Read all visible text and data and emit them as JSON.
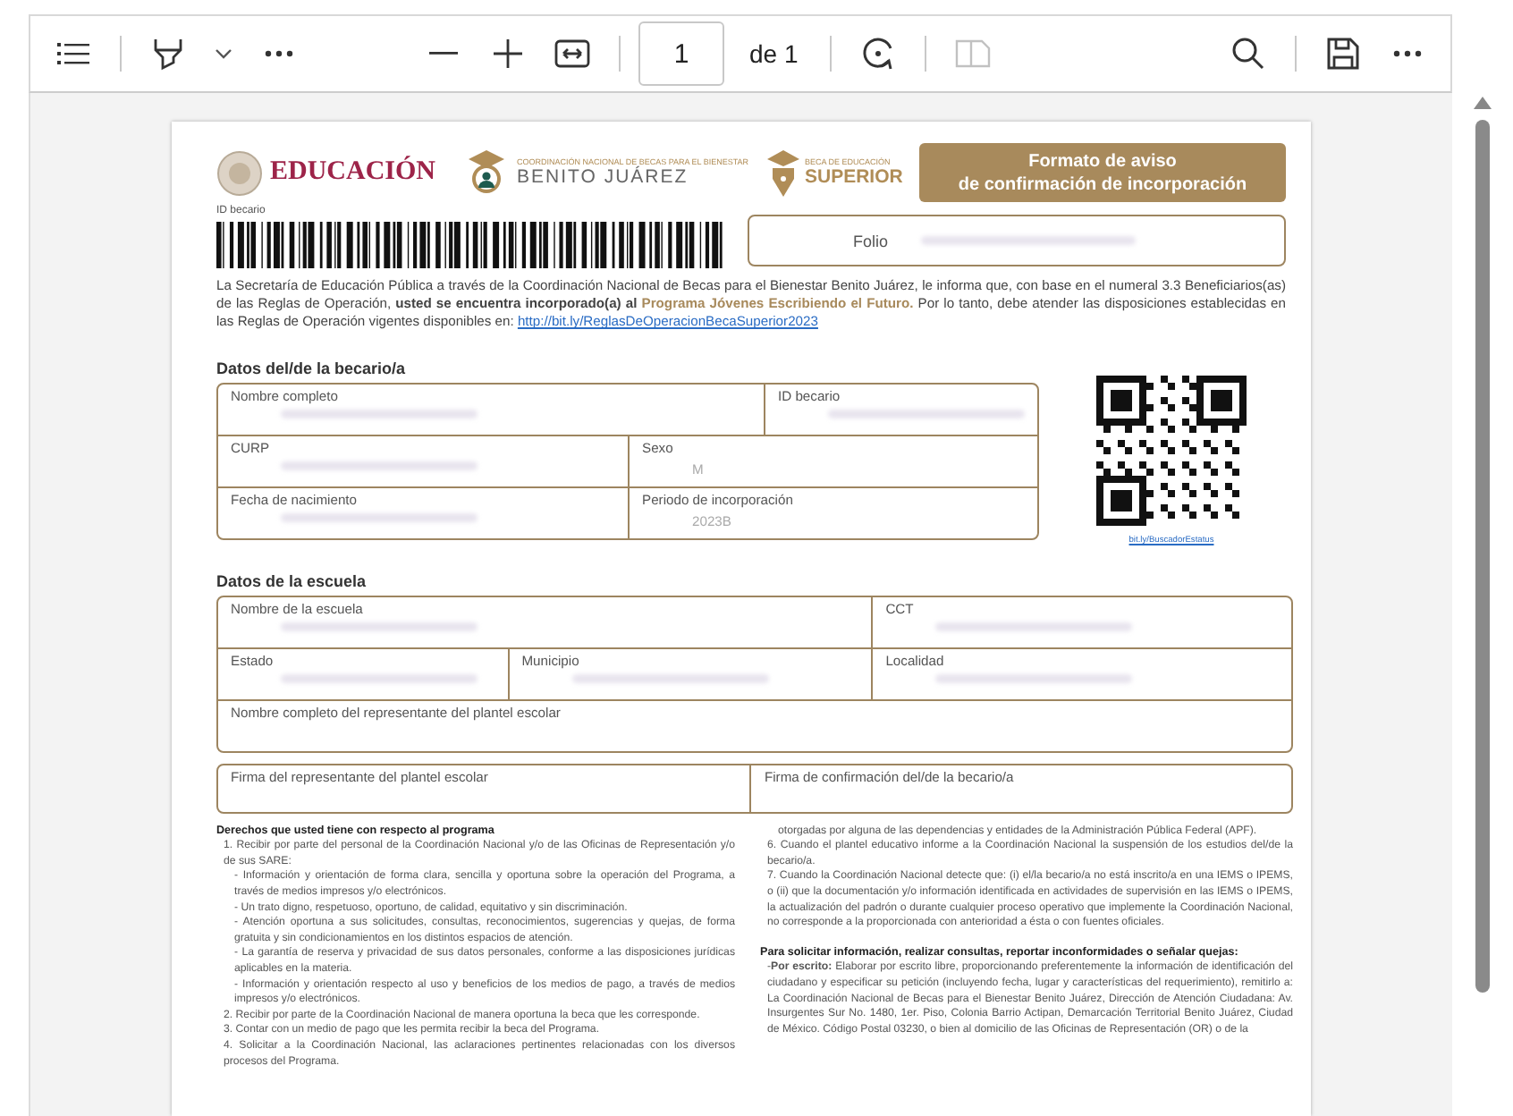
{
  "toolbar": {
    "left": [
      {
        "kind": "contents",
        "disabled": false
      },
      {
        "kind": "divider"
      },
      {
        "kind": "highlighter",
        "disabled": false
      },
      {
        "kind": "chevron",
        "disabled": false
      },
      {
        "kind": "more",
        "disabled": false
      }
    ],
    "center": [
      {
        "kind": "zoom-out",
        "disabled": false
      },
      {
        "kind": "zoom-in",
        "disabled": false
      },
      {
        "kind": "fit-width",
        "disabled": false
      },
      {
        "kind": "divider"
      },
      {
        "kind": "page-field",
        "value": "1"
      },
      {
        "kind": "page-count",
        "text": "de 1"
      },
      {
        "kind": "divider"
      },
      {
        "kind": "rotate",
        "disabled": false
      },
      {
        "kind": "divider"
      },
      {
        "kind": "two-page",
        "disabled": true
      }
    ],
    "right": [
      {
        "kind": "search",
        "disabled": false
      },
      {
        "kind": "divider"
      },
      {
        "kind": "save",
        "disabled": false
      },
      {
        "kind": "more",
        "disabled": false
      }
    ]
  },
  "document": {
    "logos": {
      "sep": "EDUCACIÓN",
      "coordination_small": "COORDINACIÓN NACIONAL DE BECAS PARA EL BIENESTAR",
      "coordination": "BENITO JUÁREZ",
      "scholarship_small": "BECA DE EDUCACIÓN",
      "scholarship": "SUPERIOR"
    },
    "title_lines": [
      "Formato de aviso",
      "de confirmación de incorporación"
    ],
    "barcode_label": "ID becario",
    "folio_label": "Folio",
    "intro": {
      "text": "La Secretaría de Educación Pública a través de la Coordinación Nacional de Becas para el Bienestar Benito Juárez, le informa que, con base en el numeral 3.3 Beneficiarios(as) de las Reglas de Operación, **usted se encuentra incorporado(a) al**",
      "program": "Programa Jóvenes Escribiendo el Futuro.",
      "after": "Por lo tanto, debe atender las disposiciones establecidas en las Reglas de Operación vigentes disponibles en:",
      "link": "http://bit.ly/ReglasDeOperacionBecaSuperior2023"
    },
    "student": {
      "heading": "Datos del/de la becario/a",
      "rows": [
        [
          {
            "label": "Nombre completo",
            "redacted": true
          },
          {
            "label": "ID becario",
            "redacted": true
          }
        ],
        [
          {
            "label": "CURP",
            "redacted": true
          },
          {
            "label": "Sexo",
            "value": "M"
          }
        ],
        [
          {
            "label": "Fecha de nacimiento",
            "redacted": true
          },
          {
            "label": "Periodo de incorporación",
            "value": "2023B"
          }
        ]
      ],
      "qr_link": "bit.ly/BuscadorEstatus"
    },
    "school": {
      "heading": "Datos de la escuela",
      "lines": [
        [
          {
            "label": "Nombre de la escuela",
            "redacted": true
          },
          {
            "label": "CCT",
            "redacted": true
          }
        ],
        [
          {
            "label": "Estado",
            "redacted": true
          },
          {
            "label": "Municipio",
            "redacted": true
          },
          {
            "label": "Localidad",
            "redacted": true
          }
        ],
        [
          {
            "label": "Nombre completo del representante del plantel escolar"
          }
        ]
      ]
    },
    "signatures": [
      {
        "label": "Firma del representante del plantel escolar"
      },
      {
        "label": "Firma de confirmación del/de la becario/a"
      }
    ],
    "rights": {
      "heading": "Derechos que usted tiene con respecto al programa",
      "items": [
        {
          "kind": "item",
          "text": "1. Recibir por parte del personal de la Coordinación Nacional y/o de las Oficinas de Representación y/o de sus SARE:"
        },
        {
          "kind": "sub",
          "text": "- Información y orientación de forma clara, sencilla y oportuna sobre la operación del Programa, a través de medios impresos y/o electrónicos."
        },
        {
          "kind": "sub",
          "text": "- Un trato digno, respetuoso, oportuno, de calidad, equitativo y sin discriminación."
        },
        {
          "kind": "sub",
          "text": "- Atención oportuna a sus solicitudes, consultas, reconocimientos, sugerencias y quejas, de forma gratuita y sin condicionamientos en los distintos espacios de atención."
        },
        {
          "kind": "sub",
          "text": "- La garantía de reserva y privacidad de sus datos personales, conforme a las disposiciones jurídicas aplicables en la materia."
        },
        {
          "kind": "sub",
          "text": "- Información y orientación respecto al uso y beneficios de los medios de pago, a través de medios impresos y/o electrónicos."
        },
        {
          "kind": "item",
          "text": "2. Recibir por parte de la Coordinación Nacional de manera oportuna la beca que les corresponde."
        },
        {
          "kind": "item",
          "text": "3. Contar con un medio de pago que les permita recibir la beca del Programa."
        },
        {
          "kind": "item",
          "text": "4. Solicitar a la Coordinación Nacional, las aclaraciones pertinentes relacionadas con los diversos procesos del Programa."
        }
      ]
    },
    "right_column": [
      {
        "kind": "sub",
        "text": "otorgadas por alguna de las dependencias y entidades de la Administración Pública Federal (APF)."
      },
      {
        "kind": "item",
        "text": "6. Cuando el plantel educativo informe a la Coordinación Nacional la suspensión de los estudios del/de la becario/a."
      },
      {
        "kind": "item",
        "text": "7. Cuando la Coordinación Nacional detecte que: (i) el/la becario/a no está inscrito/a en una IEMS o IPEMS, o (ii) que la documentación y/o información identificada en actividades de supervisión en las IEMS o IPEMS, la actualización del padrón o durante cualquier proceso operativo que implemente la Coordinación Nacional, no corresponde a la proporcionada con anterioridad a ésta o con fuentes oficiales."
      },
      {
        "kind": "heading",
        "text": "Para solicitar información, realizar consultas, reportar inconformidades o señalar quejas:"
      },
      {
        "kind": "item",
        "text": "-**Por escrito:** Elaborar por escrito libre, proporcionando preferentemente la información de identificación del ciudadano y especificar su petición (incluyendo fecha, lugar y características del requerimiento), remitirlo a: La Coordinación Nacional de Becas para el Bienestar Benito Juárez, Dirección de Atención Ciudadana: Av. Insurgentes Sur No. 1480, 1er. Piso, Colonia Barrio Actipan, Demarcación Territorial Benito Juárez, Ciudad de México. Código Postal 03230, o bien al domicilio de las Oficinas de Representación (OR) o de la"
      }
    ]
  }
}
